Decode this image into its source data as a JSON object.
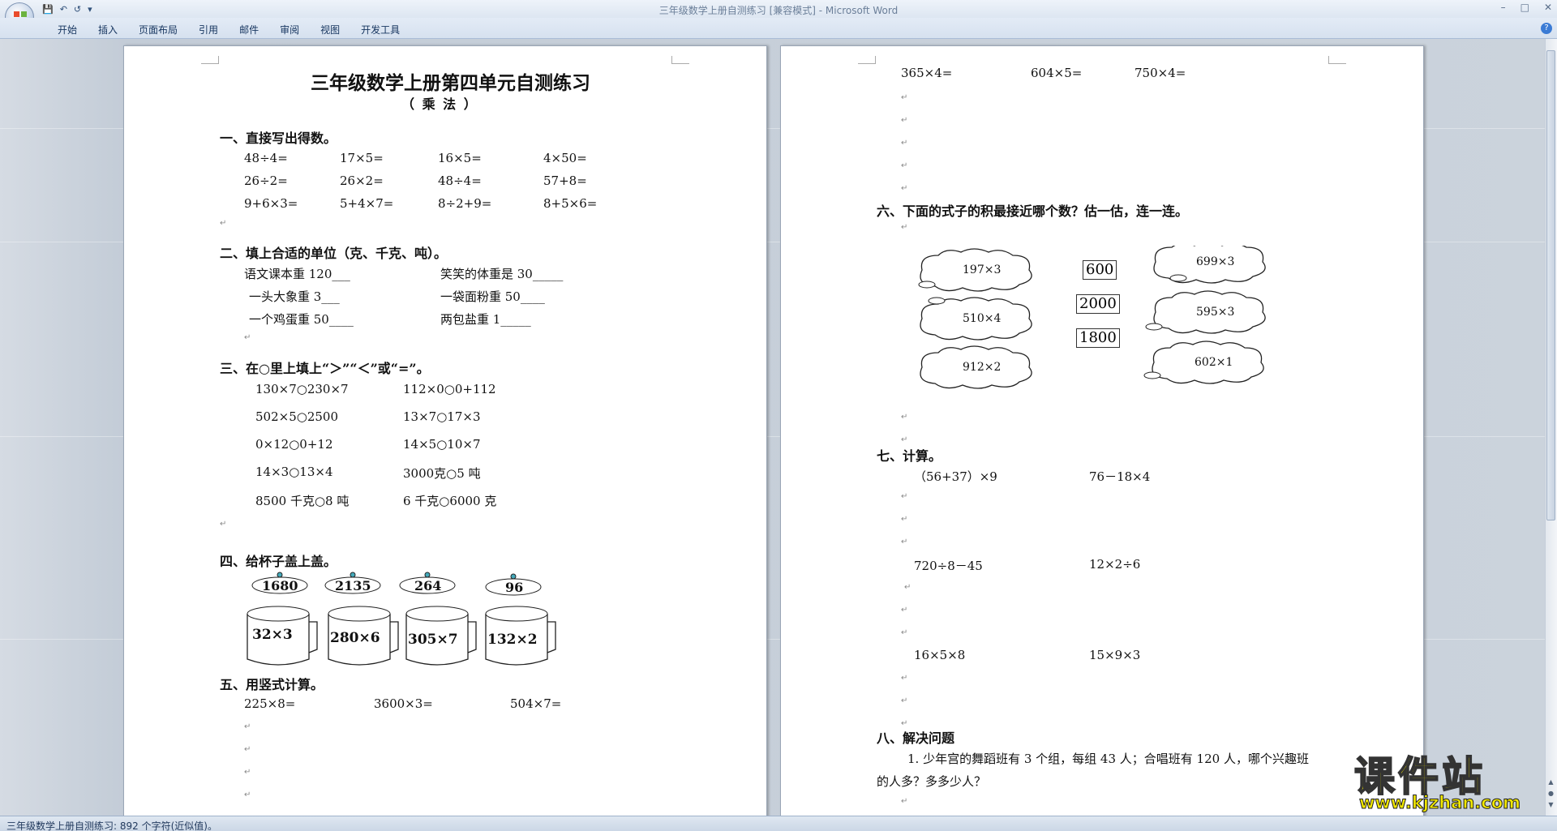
{
  "window": {
    "title": "三年级数学上册自测练习 [兼容模式] - Microsoft Word",
    "tabs": [
      "开始",
      "插入",
      "页面布局",
      "引用",
      "邮件",
      "审阅",
      "视图",
      "开发工具"
    ]
  },
  "status": {
    "text": "三年级数学上册自测练习: 892 个字符(近似值)。"
  },
  "watermark": {
    "title": "课件站",
    "url": "www.kjzhan.com"
  },
  "page1": {
    "title": "三年级数学上册第四单元自测练习",
    "subtitle": "（   乘   法   ）",
    "s1": {
      "head": "一、直接写出得数。",
      "rows": [
        [
          "48÷4=",
          "17×5=",
          "16×5=",
          "4×50="
        ],
        [
          "26÷2=",
          "26×2=",
          "48÷4=",
          "57+8="
        ],
        [
          "9+6×3=",
          "5+4×7=",
          "8÷2+9=",
          "8+5×6="
        ]
      ]
    },
    "s2": {
      "head": "二、填上合适的单位（克、千克、吨）。",
      "items": [
        "语文课本重 120___",
        "笑笑的体重是 30_____",
        "一头大象重 3___",
        "一袋面粉重 50____",
        "一个鸡蛋重 50____",
        "两包盐重 1_____"
      ]
    },
    "s3": {
      "head": "三、在○里上填上“＞”“＜”或“=”。",
      "rows": [
        [
          "130×7○230×7",
          "112×0○0+112"
        ],
        [
          "502×5○2500",
          "13×7○17×3"
        ],
        [
          "0×12○0+12",
          "14×5○10×7"
        ],
        [
          "14×3○13×4",
          "3000克○5 吨"
        ],
        [
          "8500 千克○8 吨",
          "6 千克○6000 克"
        ]
      ]
    },
    "s4": {
      "head": "四、给杯子盖上盖。",
      "lids": [
        "1680",
        "2135",
        "264",
        "96"
      ],
      "cups": [
        "32×3",
        "280×6",
        "305×7",
        "132×2"
      ]
    },
    "s5": {
      "head": "五、用竖式计算。",
      "items": [
        "225×8=",
        "3600×3=",
        "504×7="
      ]
    }
  },
  "page2": {
    "s5cont": [
      "365×4=",
      "604×5=",
      "750×4="
    ],
    "s6": {
      "head": "六、下面的式子的积最接近哪个数？估一估，连一连。",
      "left": [
        "197×3",
        "510×4",
        "912×2"
      ],
      "mid": [
        "600",
        "2000",
        "1800"
      ],
      "right": [
        "699×3",
        "595×3",
        "602×1"
      ]
    },
    "s7": {
      "head": "七、计算。",
      "rows": [
        [
          "（56+37）×9",
          "76－18×4"
        ],
        [
          "720÷8－45",
          "12×2÷6"
        ],
        [
          "16×5×8",
          "15×9×3"
        ]
      ]
    },
    "s8": {
      "head": "八、解决问题",
      "q1a": "1. 少年宫的舞蹈班有 3 个组，每组 43 人；合唱班有 120 人，哪个兴趣班",
      "q1b": "的人多？多多少人？"
    }
  }
}
